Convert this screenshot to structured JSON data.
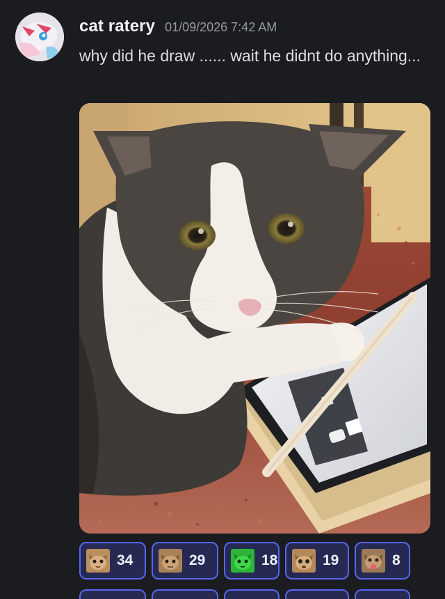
{
  "message": {
    "author": "cat ratery",
    "timestamp": "01/09/2026 7:42 AM",
    "text": "why did he draw ...... wait he didnt do anything..."
  },
  "attachment": {
    "kind": "photo",
    "subject": "cat-with-tablet-and-stylus"
  },
  "reactions": [
    {
      "emoji": "cat-face-emoji",
      "count": "34"
    },
    {
      "emoji": "cat-face-emoji",
      "count": "29"
    },
    {
      "emoji": "green-cat-emoji",
      "count": "18"
    },
    {
      "emoji": "cat-face-emoji",
      "count": "19"
    },
    {
      "emoji": "cat-tongue-emoji",
      "count": "8"
    }
  ],
  "colors": {
    "background": "#1b1c20",
    "reaction_border": "#5865f2",
    "reaction_fill": "#262a52",
    "username": "#f2f3f5",
    "timestamp": "#949ba4"
  }
}
